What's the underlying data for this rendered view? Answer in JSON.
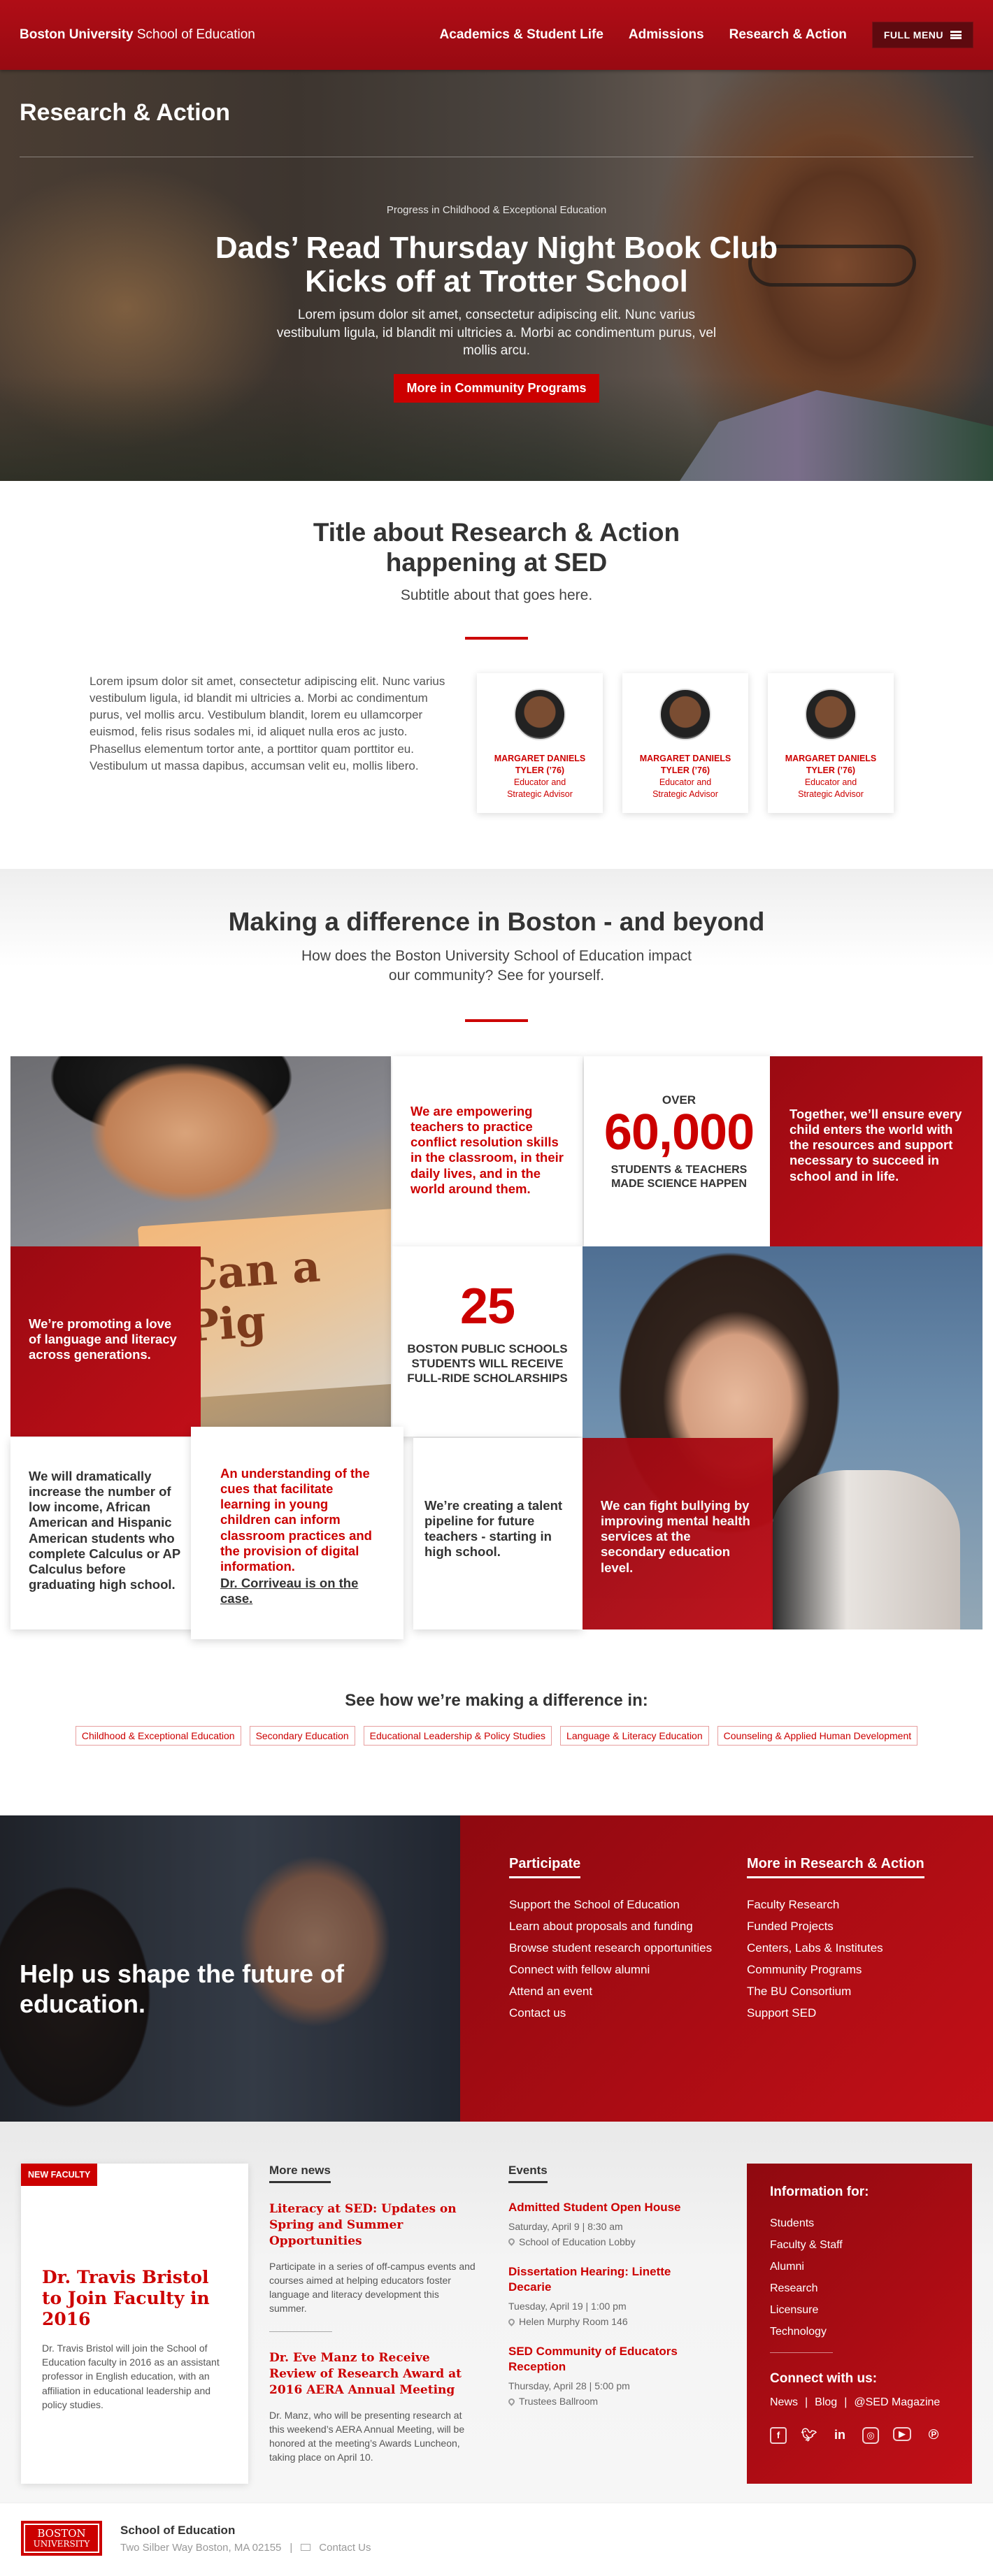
{
  "header": {
    "brand_bold": "Boston University",
    "brand_rest": " School of Education",
    "nav": [
      "Academics & Student Life",
      "Admissions",
      "Research & Action"
    ],
    "menu_label": "FULL MENU",
    "brand_color": "#cc0000"
  },
  "hero": {
    "section_title": "Research & Action",
    "kicker": "Progress in Childhood & Exceptional Education",
    "headline_1": "Dads’ Read Thursday Night Book Club",
    "headline_2": "Kicks off at Trotter School",
    "body": "Lorem ipsum dolor sit amet, consectetur adipiscing elit. Nunc varius vestibulum ligula, id blandit mi ultricies a. Morbi ac condimentum purus, vel mollis arcu.",
    "button": "More in Community Programs"
  },
  "intro": {
    "title_1": "Title about Research & Action",
    "title_2": "happening at SED",
    "subtitle": "Subtitle about that goes here.",
    "body": "Lorem ipsum dolor sit amet, consectetur adipiscing elit. Nunc varius vestibulum ligula, id blandit mi ultricies a. Morbi ac condimentum purus, vel mollis arcu. Vestibulum blandit, lorem eu ullamcorper euismod, felis risus sodales mi, id aliquet nulla eros ac justo. Phasellus elementum tortor ante, a porttitor quam porttitor eu. Vestibulum ut massa dapibus, accumsan velit eu, mollis libero.",
    "people": [
      {
        "name_1": "MARGARET DANIELS",
        "name_2": "TYLER (’76)",
        "role_1": "Educator and",
        "role_2": "Strategic Advisor"
      },
      {
        "name_1": "MARGARET DANIELS",
        "name_2": "TYLER (’76)",
        "role_1": "Educator and",
        "role_2": "Strategic Advisor"
      },
      {
        "name_1": "MARGARET DANIELS",
        "name_2": "TYLER (’76)",
        "role_1": "Educator and",
        "role_2": "Strategic Advisor"
      }
    ]
  },
  "difference": {
    "title": "Making a difference in Boston - and beyond",
    "subtitle_1": "How does the Boston University School of Education impact",
    "subtitle_2": "our community? See for yourself.",
    "book_text": "Can a Pig",
    "tiles": {
      "empower": "We are empowering teachers to practice conflict resolution skills in the classroom, in their daily lives, and in the world around them.",
      "over": "OVER",
      "big_number": "60,000",
      "big_label_1": "STUDENTS & TEACHERS",
      "big_label_2": "MADE SCIENCE HAPPEN",
      "together": "Together, we’ll ensure every child enters the world with the resources and support necessary to succeed in school and in life.",
      "promoting": "We’re promoting a love of language and literacy across generations.",
      "num25": "25",
      "num25_label_1": "BOSTON PUBLIC SCHOOLS",
      "num25_label_2": "STUDENTS WILL RECEIVE",
      "num25_label_3": "FULL-RIDE SCHOLARSHIPS",
      "increase": "We will dramatically increase the number of low income, African American and Hispanic American students who complete Calculus or AP Calculus before graduating high school.",
      "cues": "An understanding of the cues that facilitate learning in young children can inform classroom practices and the provision of digital information.",
      "cues_link": "Dr. Corriveau is on the case.",
      "pipeline": "We’re creating a talent pipeline for future teachers - starting in high school.",
      "bullying": "We can fight bullying by improving mental health services at the secondary education level."
    }
  },
  "see": {
    "title": "See how we’re making a difference in:",
    "tags": [
      "Childhood & Exceptional Education",
      "Secondary Education",
      "Educational Leadership & Policy Studies",
      "Language & Literacy Education",
      "Counseling & Applied Human Development"
    ]
  },
  "shape": {
    "headline_1": "Help us shape the future of",
    "headline_2": "education.",
    "participate_title": "Participate",
    "participate": [
      "Support the School of Education",
      "Learn about proposals and funding",
      "Browse student research opportunities",
      "Connect with fellow alumni",
      "Attend an event",
      "Contact us"
    ],
    "more_title": "More in Research & Action",
    "more": [
      "Faculty Research",
      "Funded Projects",
      "Centers, Labs & Institutes",
      "Community Programs",
      "The BU Consortium",
      "Support SED"
    ]
  },
  "new_faculty": {
    "badge": "NEW FACULTY",
    "title": "Dr. Travis Bristol to Join Faculty in 2016",
    "body": "Dr. Travis Bristol will join the School of Education faculty in 2016 as an assistant professor in English education, with an affiliation in educational leadership and policy studies."
  },
  "news": {
    "title": "More news",
    "items": [
      {
        "title": "Literacy at SED: Updates on Spring and Summer Opportunities",
        "body": "Participate in a series of off-campus events and courses aimed at helping educators foster language and literacy development this summer."
      },
      {
        "title": "Dr. Eve Manz to Receive Review of Research Award at 2016 AERA Annual Meeting",
        "body": "Dr. Manz, who will be presenting research at this weekend’s AERA Annual Meeting, will be honored at the meeting’s Awards Luncheon, taking place on April 10."
      }
    ]
  },
  "events": {
    "title": "Events",
    "items": [
      {
        "title": "Admitted Student Open House",
        "date": "Saturday, April 9 | 8:30 am",
        "place": "School of Education Lobby"
      },
      {
        "title": "Dissertation Hearing: Linette Decarie",
        "date": "Tuesday, April 19 | 1:00 pm",
        "place": "Helen Murphy Room 146"
      },
      {
        "title": "SED Community of Educators Reception",
        "date": "Thursday, April 28 | 5:00 pm",
        "place": "Trustees Ballroom"
      }
    ]
  },
  "info": {
    "title": "Information for:",
    "items": [
      "Students",
      "Faculty & Staff",
      "Alumni",
      "Research",
      "Licensure",
      "Technology"
    ],
    "connect_title": "Connect with us:",
    "links": [
      "News",
      "Blog",
      "@SED Magazine"
    ],
    "sep": "|",
    "socials": [
      "facebook-icon",
      "twitter-icon",
      "linkedin-icon",
      "instagram-icon",
      "youtube-icon",
      "pinterest-icon"
    ]
  },
  "footer": {
    "logo_1": "BOSTON",
    "logo_2": "UNIVERSITY",
    "school": "School of Education",
    "address": "Two Silber Way Boston, MA 02155",
    "sep": "|",
    "contact": "Contact Us"
  }
}
